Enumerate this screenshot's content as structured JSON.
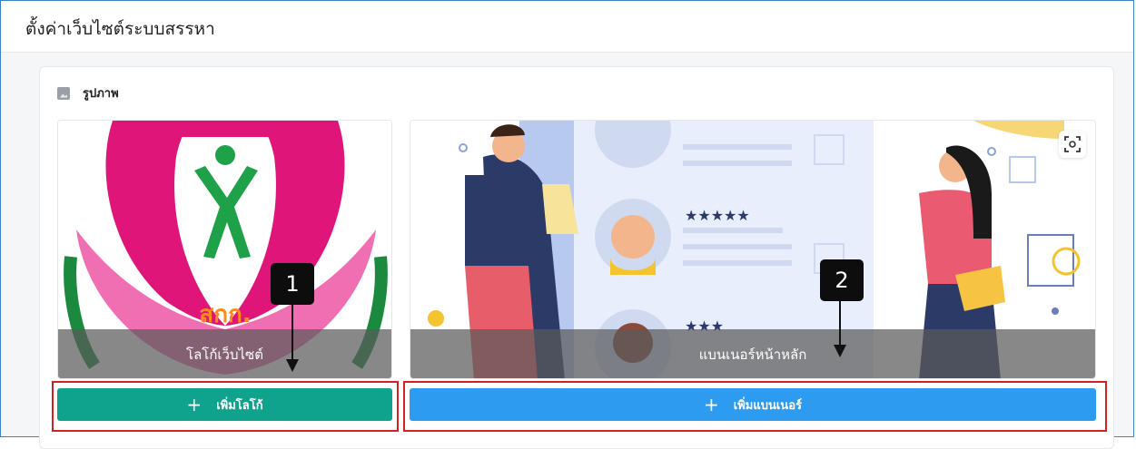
{
  "page": {
    "title": "ตั้งค่าเว็บไซต์ระบบสรรหา"
  },
  "section": {
    "label": "รูปภาพ",
    "icon": "image-icon"
  },
  "logo_tile": {
    "caption": "โลโก้เว็บไซต์",
    "logo_text": "สกก."
  },
  "banner_tile": {
    "caption": "แบนเนอร์หน้าหลัก",
    "icon": "scan-icon"
  },
  "buttons": {
    "add_logo": {
      "label": "เพิ่มโลโก้",
      "icon": "plus-icon",
      "color": "#0fa38d"
    },
    "add_banner": {
      "label": "เพิ่มแบนเนอร์",
      "icon": "plus-icon",
      "color": "#2d9cf0"
    }
  },
  "callouts": [
    {
      "label": "1"
    },
    {
      "label": "2"
    }
  ],
  "colors": {
    "highlight": "#d31f26",
    "frame": "#3b82c4"
  }
}
